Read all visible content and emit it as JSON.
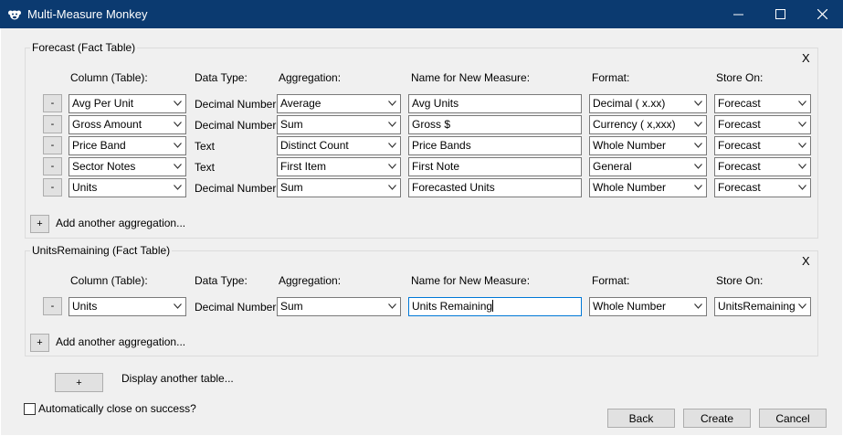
{
  "window": {
    "title": "Multi-Measure Monkey"
  },
  "headers": {
    "column": "Column (Table):",
    "data_type": "Data Type:",
    "aggregation": "Aggregation:",
    "name": "Name for New Measure:",
    "format": "Format:",
    "store_on": "Store On:"
  },
  "remove_label": "-",
  "add_label": "+",
  "close_label": "X",
  "add_aggregation_label": "Add another aggregation...",
  "sections": [
    {
      "title": "Forecast (Fact Table)",
      "rows": [
        {
          "column": "Avg Per Unit",
          "data_type": "Decimal Number",
          "aggregation": "Average",
          "name": "Avg Units",
          "format": "Decimal ( x.xx)",
          "store_on": "Forecast"
        },
        {
          "column": "Gross Amount",
          "data_type": "Decimal Number",
          "aggregation": "Sum",
          "name": "Gross $",
          "format": "Currency ( x,xxx)",
          "store_on": "Forecast"
        },
        {
          "column": "Price Band",
          "data_type": "Text",
          "aggregation": "Distinct Count",
          "name": "Price Bands",
          "format": "Whole Number",
          "store_on": "Forecast"
        },
        {
          "column": "Sector Notes",
          "data_type": "Text",
          "aggregation": "First Item",
          "name": "First Note",
          "format": "General",
          "store_on": "Forecast"
        },
        {
          "column": "Units",
          "data_type": "Decimal Number",
          "aggregation": "Sum",
          "name": "Forecasted Units",
          "format": "Whole Number",
          "store_on": "Forecast"
        }
      ]
    },
    {
      "title": "UnitsRemaining (Fact Table)",
      "rows": [
        {
          "column": "Units",
          "data_type": "Decimal Number",
          "aggregation": "Sum",
          "name": "Units Remaining",
          "format": "Whole Number",
          "store_on": "UnitsRemaining"
        }
      ]
    }
  ],
  "display_table_label": "Display another table...",
  "auto_close_label": "Automatically close on success?",
  "buttons": {
    "back": "Back",
    "create": "Create",
    "cancel": "Cancel"
  }
}
